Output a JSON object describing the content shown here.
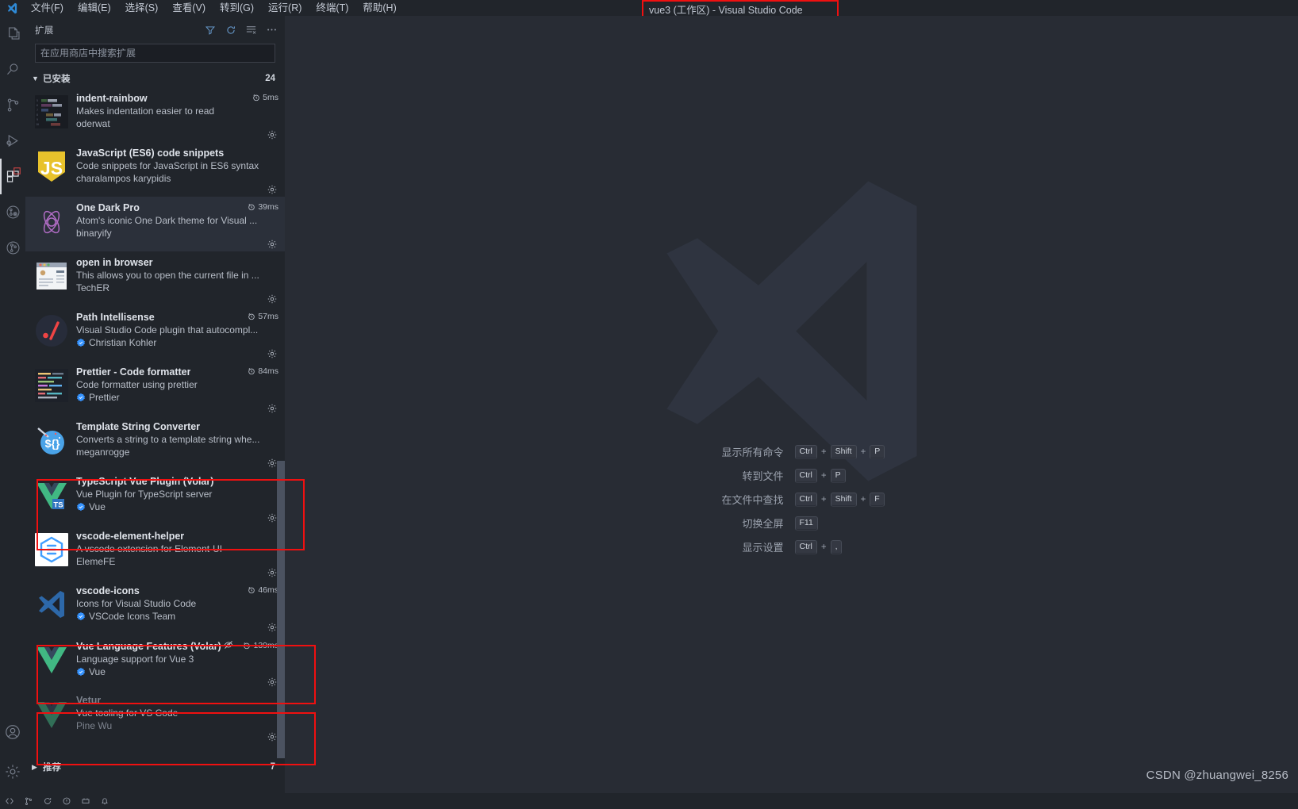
{
  "window": {
    "title": "vue3 (工作区) - Visual Studio Code",
    "logo_name": "vscode-logo"
  },
  "menubar": {
    "items": [
      {
        "label": "文件(F)",
        "name": "menu-file"
      },
      {
        "label": "编辑(E)",
        "name": "menu-edit"
      },
      {
        "label": "选择(S)",
        "name": "menu-selection"
      },
      {
        "label": "查看(V)",
        "name": "menu-view"
      },
      {
        "label": "转到(G)",
        "name": "menu-go"
      },
      {
        "label": "运行(R)",
        "name": "menu-run"
      },
      {
        "label": "终端(T)",
        "name": "menu-terminal"
      },
      {
        "label": "帮助(H)",
        "name": "menu-help"
      }
    ]
  },
  "activitybar": {
    "items": [
      {
        "name": "explorer-icon",
        "title": "资源管理器",
        "active": false
      },
      {
        "name": "search-icon",
        "title": "搜索",
        "active": false
      },
      {
        "name": "source-control-icon",
        "title": "源代码管理",
        "active": false
      },
      {
        "name": "run-debug-icon",
        "title": "运行和调试",
        "active": false
      },
      {
        "name": "extensions-icon",
        "title": "扩展",
        "active": true
      },
      {
        "name": "test-explorer-icon",
        "title": "测试",
        "active": false
      },
      {
        "name": "git-graph-icon",
        "title": "Git Graph",
        "active": false
      }
    ],
    "bottom": [
      {
        "name": "accounts-icon",
        "title": "账户"
      },
      {
        "name": "manage-gear-icon",
        "title": "管理"
      }
    ]
  },
  "sidebar": {
    "title": "扩展",
    "actions": [
      {
        "name": "filter-icon",
        "label": "筛选扩展"
      },
      {
        "name": "refresh-icon",
        "label": "刷新"
      },
      {
        "name": "clear-list-icon",
        "label": "清除搜索结果"
      },
      {
        "name": "more-actions-icon",
        "label": "视图和更多操作..."
      }
    ],
    "search": {
      "placeholder": "在应用商店中搜索扩展",
      "value": ""
    },
    "installed_section": {
      "label": "已安装",
      "count": "24",
      "chevron": "chevron-down-icon"
    },
    "recommended_section": {
      "label": "推荐",
      "count": "7",
      "chevron": "chevron-right-icon"
    },
    "extensions": [
      {
        "name": "indent-rainbow",
        "description": "Makes indentation easier to read",
        "publisher": "oderwat",
        "verified": false,
        "activation_time": "5ms",
        "disabled": false,
        "icon": "indent-rainbow-icon",
        "highlight": false
      },
      {
        "name": "JavaScript (ES6) code snippets",
        "description": "Code snippets for JavaScript in ES6 syntax",
        "publisher": "charalampos karypidis",
        "verified": false,
        "activation_time": "",
        "disabled": false,
        "icon": "javascript-icon",
        "highlight": false
      },
      {
        "name": "One Dark Pro",
        "description": "Atom's iconic One Dark theme for Visual ...",
        "publisher": "binaryify",
        "verified": false,
        "activation_time": "39ms",
        "disabled": false,
        "icon": "one-dark-pro-icon",
        "highlight": false
      },
      {
        "name": "open in browser",
        "description": "This allows you to open the current file in ...",
        "publisher": "TechER",
        "verified": false,
        "activation_time": "",
        "disabled": false,
        "icon": "open-in-browser-icon",
        "highlight": false
      },
      {
        "name": "Path Intellisense",
        "description": "Visual Studio Code plugin that autocompl...",
        "publisher": "Christian Kohler",
        "verified": true,
        "activation_time": "57ms",
        "disabled": false,
        "icon": "path-intellisense-icon",
        "highlight": false
      },
      {
        "name": "Prettier - Code formatter",
        "description": "Code formatter using prettier",
        "publisher": "Prettier",
        "verified": true,
        "activation_time": "84ms",
        "disabled": false,
        "icon": "prettier-icon",
        "highlight": false
      },
      {
        "name": "Template String Converter",
        "description": "Converts a string to a template string whe...",
        "publisher": "meganrogge",
        "verified": false,
        "activation_time": "",
        "disabled": false,
        "icon": "template-string-converter-icon",
        "highlight": false
      },
      {
        "name": "TypeScript Vue Plugin (Volar)",
        "description": "Vue Plugin for TypeScript server",
        "publisher": "Vue",
        "verified": true,
        "activation_time": "",
        "disabled": false,
        "icon": "typescript-vue-plugin-icon",
        "highlight": true
      },
      {
        "name": "vscode-element-helper",
        "description": "A vscode extension for Element-UI",
        "publisher": "ElemeFE",
        "verified": false,
        "activation_time": "",
        "disabled": false,
        "icon": "vscode-element-helper-icon",
        "highlight": false
      },
      {
        "name": "vscode-icons",
        "description": "Icons for Visual Studio Code",
        "publisher": "VSCode Icons Team",
        "verified": true,
        "activation_time": "46ms",
        "disabled": false,
        "icon": "vscode-icons-icon",
        "highlight": false
      },
      {
        "name": "Vue Language Features (Volar)",
        "description": "Language support for Vue 3",
        "publisher": "Vue",
        "verified": true,
        "activation_time": "139ms",
        "disabled": false,
        "status_icon": "eye-off-icon",
        "icon": "volar-icon",
        "highlight": true
      },
      {
        "name": "Vetur",
        "description": "Vue tooling for VS Code",
        "publisher": "Pine Wu",
        "verified": false,
        "activation_time": "",
        "disabled": true,
        "icon": "vetur-icon",
        "highlight": true
      }
    ]
  },
  "editor": {
    "watermark_logo": "vscode-large-logo",
    "shortcuts": [
      {
        "label": "显示所有命令",
        "keys": [
          "Ctrl",
          "Shift",
          "P"
        ]
      },
      {
        "label": "转到文件",
        "keys": [
          "Ctrl",
          "P"
        ]
      },
      {
        "label": "在文件中查找",
        "keys": [
          "Ctrl",
          "Shift",
          "F"
        ]
      },
      {
        "label": "切换全屏",
        "keys": [
          "F11"
        ]
      },
      {
        "label": "显示设置",
        "keys": [
          "Ctrl",
          ","
        ]
      }
    ]
  },
  "statusbar": {
    "items": [
      {
        "name": "remote-indicator",
        "label": ""
      },
      {
        "name": "git-branch",
        "label": ""
      },
      {
        "name": "sync-status",
        "label": ""
      },
      {
        "name": "problems",
        "label": ""
      },
      {
        "name": "ports",
        "label": ""
      },
      {
        "name": "notifications",
        "label": ""
      }
    ]
  },
  "watermark_credit": "CSDN @zhuangwei_8256",
  "colors": {
    "accent": "#3794ff",
    "highlight_box": "#f01010",
    "bg": "#282c34",
    "panel_bg": "#21252b",
    "alt_row": "#2b303a"
  }
}
